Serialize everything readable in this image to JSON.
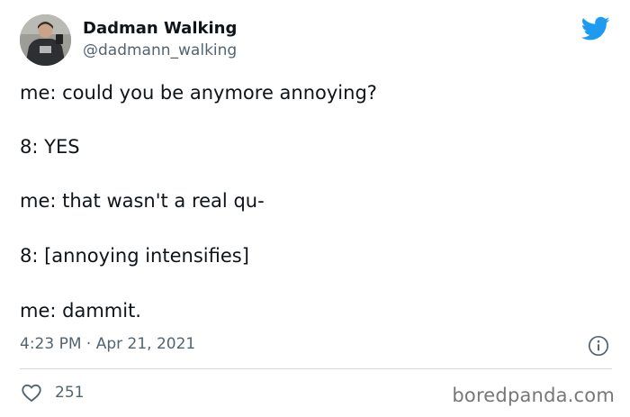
{
  "header": {
    "display_name": "Dadman Walking",
    "handle": "@dadmann_walking",
    "brand_icon": "twitter-bird-icon",
    "brand_color": "#1d9bf0"
  },
  "tweet": {
    "lines": [
      "me: could you be anymore annoying?",
      "8: YES",
      "me: that wasn't a real qu-",
      "8: [annoying intensifies]",
      "me: dammit."
    ]
  },
  "meta": {
    "timestamp": "4:23 PM · Apr 21, 2021",
    "info_icon": "info-icon"
  },
  "actions": {
    "like_icon": "heart-icon",
    "like_count": "251"
  },
  "watermark": "boredpanda.com",
  "colors": {
    "text": "#0f1419",
    "secondary": "#536471",
    "divider": "#cfd9de"
  }
}
